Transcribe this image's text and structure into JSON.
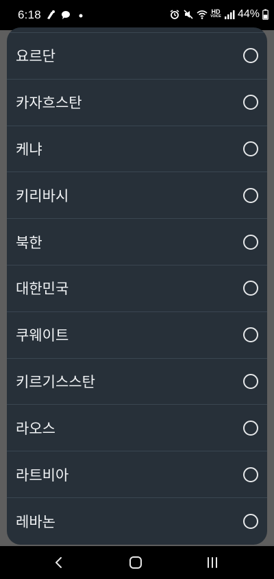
{
  "status_bar": {
    "time": "6:18",
    "battery_percent": "44%",
    "hd_voice_top": "HD",
    "hd_voice_bottom": "VOICE",
    "icons": [
      "notification-icon",
      "chat-icon",
      "dot-icon",
      "alarm-icon",
      "mute-icon",
      "wifi-icon",
      "hd-voice-icon",
      "signal-icon",
      "battery-icon"
    ]
  },
  "country_list": {
    "items": [
      {
        "label": "요르단",
        "selected": false
      },
      {
        "label": "카자흐스탄",
        "selected": false
      },
      {
        "label": "케냐",
        "selected": false
      },
      {
        "label": "키리바시",
        "selected": false
      },
      {
        "label": "북한",
        "selected": false
      },
      {
        "label": "대한민국",
        "selected": false
      },
      {
        "label": "쿠웨이트",
        "selected": false
      },
      {
        "label": "키르기스스탄",
        "selected": false
      },
      {
        "label": "라오스",
        "selected": false
      },
      {
        "label": "라트비아",
        "selected": false
      },
      {
        "label": "레바논",
        "selected": false
      }
    ]
  },
  "nav_bar": {
    "icons": [
      "back-icon",
      "home-icon",
      "recent-apps-icon"
    ]
  },
  "colors": {
    "sheet_background": "#273039",
    "divider": "#3a4651",
    "scrim": "#5e5e5e",
    "text": "#f2f4f6"
  }
}
